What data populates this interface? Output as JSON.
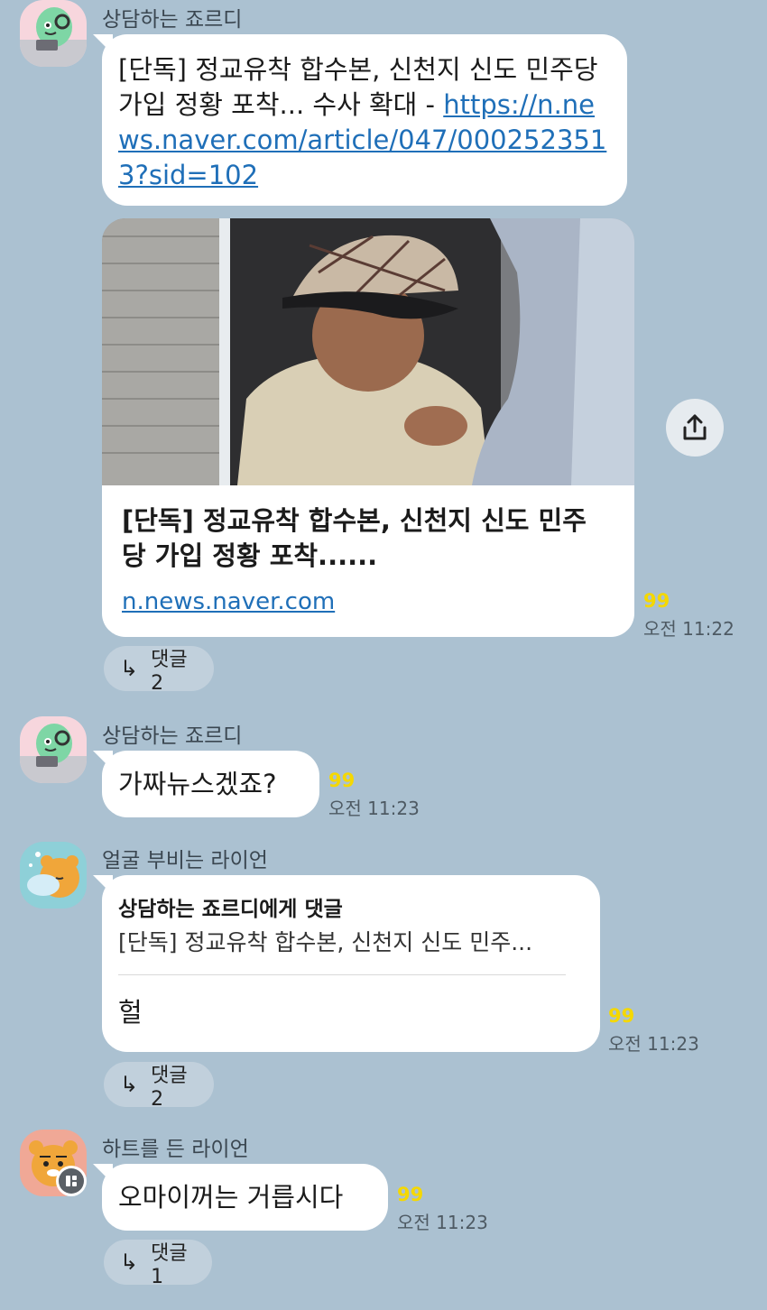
{
  "messages": [
    {
      "sender": "상담하는 죠르디",
      "text_prefix": "[단독] 정교유착 합수본, 신천지 신도 민주당 가입 정황 포착... 수사 확대 - ",
      "link_text": "https://n.news.naver.com/article/047/0002523513?sid=102",
      "preview": {
        "title": "[단독] 정교유착 합수본, 신천지 신도 민주당 가입 정황 포착......",
        "domain": "n.news.naver.com"
      },
      "unread": "99",
      "time": "오전 11:22",
      "reply_label": "댓글 2"
    },
    {
      "sender": "상담하는 죠르디",
      "text": "가짜뉴스겠죠?",
      "unread": "99",
      "time": "오전 11:23"
    },
    {
      "sender": "얼굴 부비는 라이언",
      "quote_title": "상담하는 죠르디에게 댓글",
      "quote_text": "[단독] 정교유착 합수본, 신천지 신도 민주...",
      "text": "헐",
      "unread": "99",
      "time": "오전 11:23",
      "reply_label": "댓글 2"
    },
    {
      "sender": "하트를 든 라이언",
      "text": "오마이꺼는 거릅시다",
      "unread": "99",
      "time": "오전 11:23",
      "reply_label": "댓글 1"
    }
  ],
  "icons": {
    "share": "share-icon",
    "reply_arrow": "reply-arrow-icon",
    "badge": "grid-badge-icon"
  },
  "colors": {
    "background": "#abc1d1",
    "bubble": "#ffffff",
    "link": "#1f6fb8",
    "unread": "#f5d800"
  }
}
